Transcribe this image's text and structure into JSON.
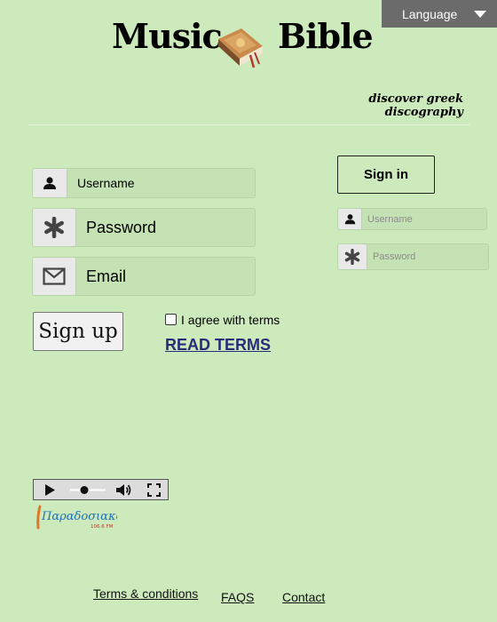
{
  "header": {
    "title_left": "Music",
    "title_right": "Bible",
    "tagline": "discover greek discography",
    "logo_icon": "book-icon"
  },
  "language_button": {
    "label": "Language",
    "icon": "caret-down-icon"
  },
  "signup_form": {
    "username": {
      "placeholder": "Username",
      "icon": "user-icon"
    },
    "password": {
      "placeholder": "Password",
      "icon": "asterisk-icon"
    },
    "email": {
      "placeholder": "Email",
      "icon": "envelope-icon"
    },
    "submit_label": "Sign up",
    "agree_label": "I agree with terms",
    "agree_checked": false,
    "read_terms_label": "READ TERMS"
  },
  "signin_form": {
    "submit_label": "Sign in",
    "username": {
      "placeholder": "Username",
      "icon": "user-icon"
    },
    "password": {
      "placeholder": "Password",
      "icon": "asterisk-icon"
    }
  },
  "audio_player": {
    "icons": [
      "play-icon",
      "volume-icon",
      "fullscreen-icon"
    ],
    "volume_level": 0.4
  },
  "radio_logo": {
    "name": "Παραδοσιακός",
    "frequency": "106.6 FM"
  },
  "footer": {
    "terms": "Terms & conditions",
    "faqs": "FAQS",
    "contact": "Contact"
  },
  "colors": {
    "background": "#cdeabd",
    "language_button": "#6b6b6b",
    "link": "#2a2b78",
    "radio_logo": "#1f6fb5"
  }
}
